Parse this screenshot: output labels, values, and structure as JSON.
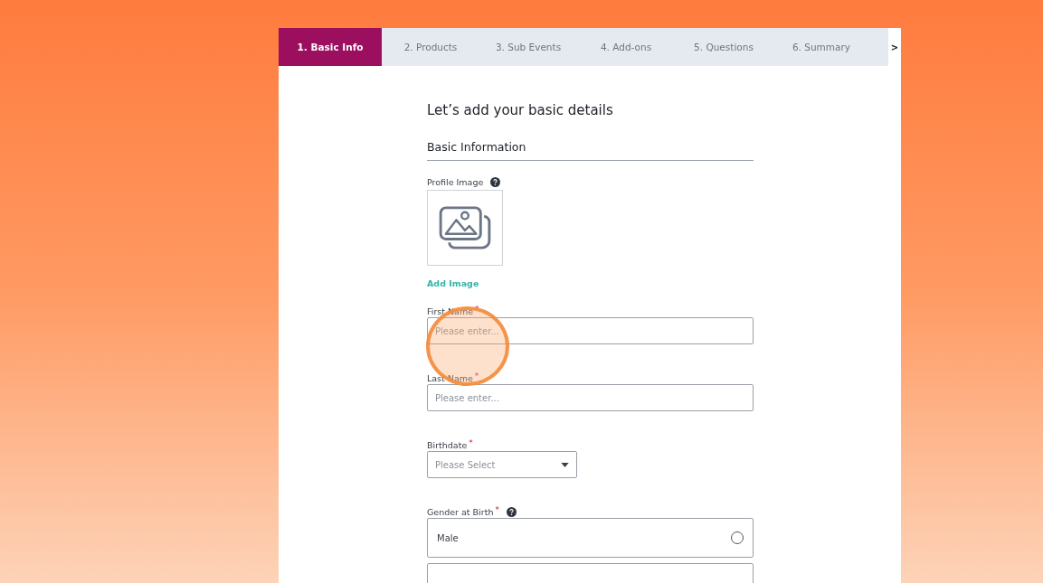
{
  "tabs": [
    {
      "label": "1. Basic Info",
      "selected": true
    },
    {
      "label": "2. Products",
      "selected": false
    },
    {
      "label": "3. Sub Events",
      "selected": false
    },
    {
      "label": "4. Add-ons",
      "selected": false
    },
    {
      "label": "5. Questions",
      "selected": false
    },
    {
      "label": "6. Summary",
      "selected": false
    }
  ],
  "next_arrow": ">",
  "form": {
    "heading": "Let’s add your basic details",
    "section_title": "Basic Information",
    "profile_image": {
      "label": "Profile Image",
      "help": true,
      "action": "Add Image"
    },
    "fields": [
      {
        "kind": "text",
        "label": "First Name",
        "required_mark": "*",
        "help": false,
        "placeholder": "Please enter..."
      },
      {
        "kind": "text",
        "label": "Last Name",
        "required_mark": "*",
        "help": false,
        "placeholder": "Please enter..."
      },
      {
        "kind": "select",
        "label": "Birthdate",
        "required_mark": "*",
        "help": false,
        "placeholder": "Please Select"
      },
      {
        "kind": "radio",
        "label": "Gender at Birth",
        "required_mark": "*",
        "help": true,
        "options": [
          {
            "label": "Male",
            "selected": false
          }
        ]
      }
    ]
  }
}
